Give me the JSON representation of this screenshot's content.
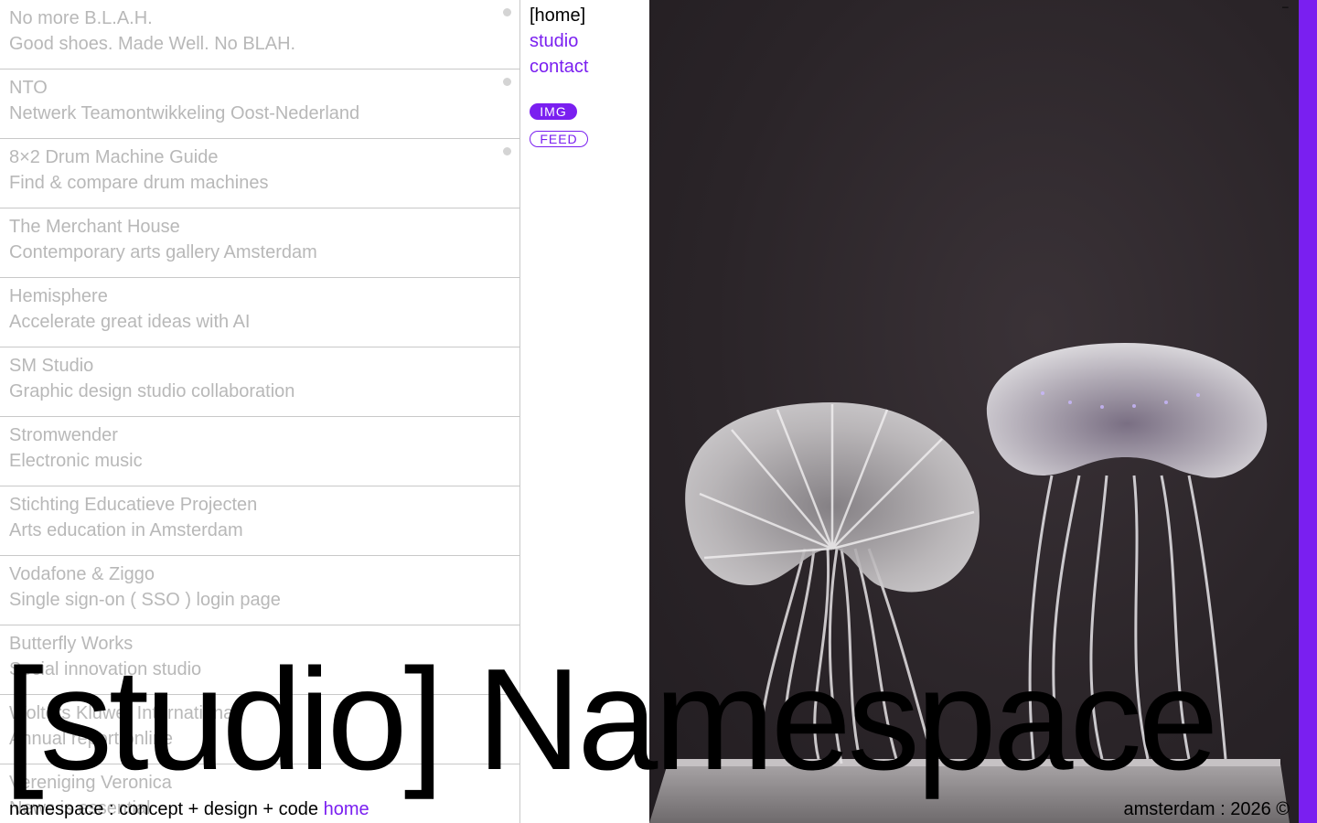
{
  "projects": [
    {
      "title": "No more B.L.A.H.",
      "subtitle": "Good shoes. Made Well. No BLAH.",
      "dot": true
    },
    {
      "title": "NTO",
      "subtitle": "Netwerk Teamontwikkeling Oost-Nederland",
      "dot": true
    },
    {
      "title": "8×2 Drum Machine Guide",
      "subtitle": "Find & compare drum machines",
      "dot": true
    },
    {
      "title": "The Merchant House",
      "subtitle": "Contemporary arts gallery Amsterdam",
      "dot": false
    },
    {
      "title": "Hemisphere",
      "subtitle": "Accelerate great ideas with AI",
      "dot": false
    },
    {
      "title": "SM Studio",
      "subtitle": "Graphic design studio collaboration",
      "dot": false
    },
    {
      "title": "Stromwender",
      "subtitle": "Electronic music",
      "dot": false
    },
    {
      "title": "Stichting Educatieve Projecten",
      "subtitle": "Arts education in Amsterdam",
      "dot": false
    },
    {
      "title": "Vodafone & Ziggo",
      "subtitle": "Single sign-on ( SSO ) login page",
      "dot": false
    },
    {
      "title": "Butterfly Works",
      "subtitle": "Social innovation studio",
      "dot": false
    },
    {
      "title": "Wolters Kluwer International",
      "subtitle": "Annual report online",
      "dot": false
    },
    {
      "title": "Vereniging Veronica",
      "subtitle": "News is essential",
      "dot": false
    }
  ],
  "nav": {
    "home": "[home]",
    "studio": "studio",
    "contact": "contact"
  },
  "filters": {
    "img": "IMG",
    "feed": "FEED"
  },
  "corner_mark": "–",
  "headline": "[studio] Namespace",
  "footer": {
    "tagline": "namespace : concept + design + code",
    "home_link": "home",
    "location": "amsterdam : 2026 ©"
  },
  "colors": {
    "accent": "#7a1ff0",
    "muted_text": "#b8b8b8",
    "panel_bg": "#2a2428"
  },
  "image": {
    "subject": "two translucent jellyfish sculptures"
  }
}
